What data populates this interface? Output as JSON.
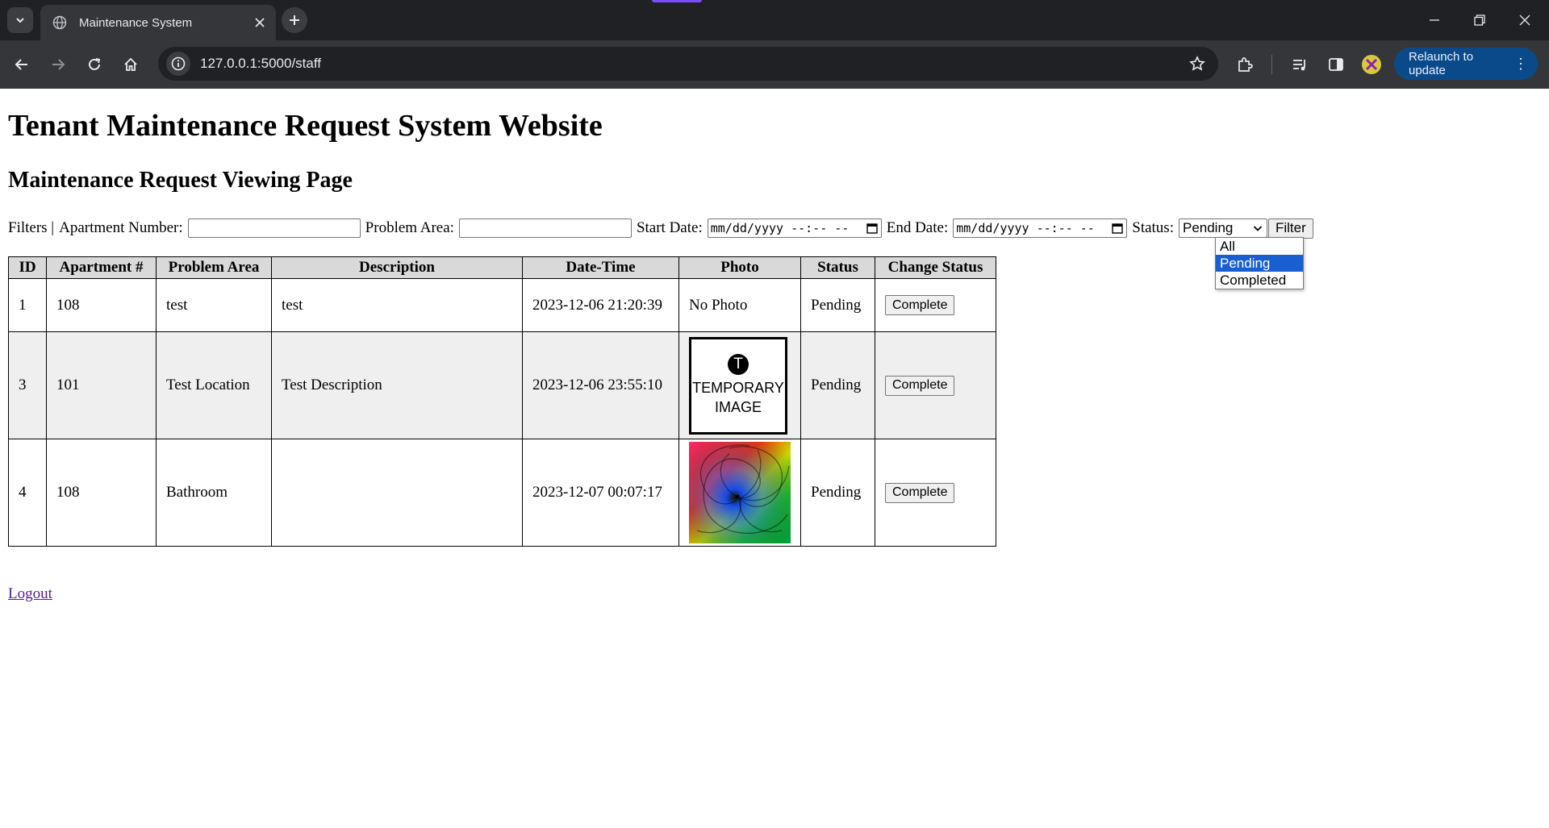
{
  "browser": {
    "tab_title": "Maintenance System",
    "url": "127.0.0.1:5000/staff",
    "relaunch_label": "Relaunch to update",
    "accent_color": "#7c4dff"
  },
  "page": {
    "title": "Tenant Maintenance Request System Website",
    "subtitle": "Maintenance Request Viewing Page"
  },
  "filters": {
    "label": "Filters |",
    "apartment_label": "Apartment Number:",
    "apartment_value": "",
    "problem_area_label": "Problem Area:",
    "problem_area_value": "",
    "start_date_label": "Start Date:",
    "start_date_placeholder": "mm/dd/yyyy --:-- --",
    "end_date_label": "End Date:",
    "end_date_placeholder": "mm/dd/yyyy --:-- --",
    "status_label": "Status:",
    "status_selected": "Pending",
    "status_options": [
      "All",
      "Pending",
      "Completed"
    ],
    "filter_button": "Filter"
  },
  "table": {
    "headers": [
      "ID",
      "Apartment #",
      "Problem Area",
      "Description",
      "Date-Time",
      "Photo",
      "Status",
      "Change Status"
    ],
    "rows": [
      {
        "id": "1",
        "apartment": "108",
        "problem_area": "test",
        "description": "test",
        "datetime": "2023-12-06 21:20:39",
        "photo": "No Photo",
        "status": "Pending",
        "action": "Complete"
      },
      {
        "id": "3",
        "apartment": "101",
        "problem_area": "Test Location",
        "description": "Test Description",
        "datetime": "2023-12-06 23:55:10",
        "photo_letter": "T",
        "photo_line1": "TEMPORARY",
        "photo_line2": "IMAGE",
        "status": "Pending",
        "action": "Complete"
      },
      {
        "id": "4",
        "apartment": "108",
        "problem_area": "Bathroom",
        "description": "",
        "datetime": "2023-12-07 00:07:17",
        "photo": "swirl-image",
        "status": "Pending",
        "action": "Complete"
      }
    ]
  },
  "logout_label": "Logout"
}
